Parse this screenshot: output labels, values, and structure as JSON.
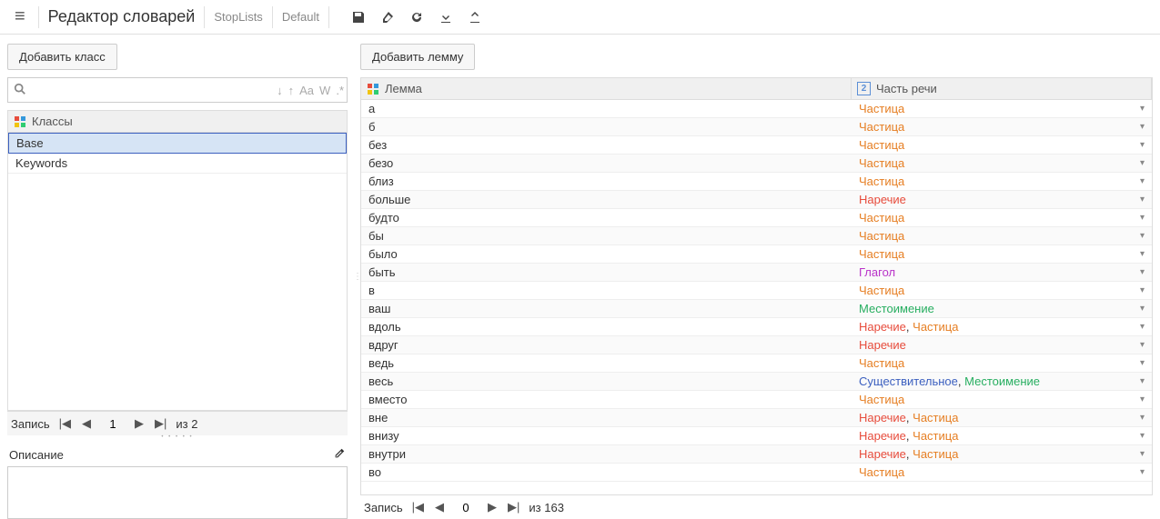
{
  "header": {
    "title": "Редактор словарей",
    "breadcrumbs": [
      "StopLists",
      "Default"
    ]
  },
  "left": {
    "add_class_label": "Добавить класс",
    "search_placeholder": "",
    "search_opts": [
      "↓",
      "↑",
      "Aa",
      "W",
      ".*"
    ],
    "classes_header": "Классы",
    "classes": [
      "Base",
      "Keywords"
    ],
    "selected_class_index": 0,
    "pager": {
      "label": "Запись",
      "current": "1",
      "of_label": "из 2"
    },
    "description_label": "Описание"
  },
  "right": {
    "add_lemma_label": "Добавить лемму",
    "columns": {
      "lemma": "Лемма",
      "pos": "Часть речи",
      "pos_badge": "2"
    },
    "pager": {
      "label": "Запись",
      "current": "0",
      "of_label": "из 163"
    },
    "rows": [
      {
        "lemma": "а",
        "pos": [
          {
            "text": "Частица",
            "cls": "pos-particle"
          }
        ]
      },
      {
        "lemma": "б",
        "pos": [
          {
            "text": "Частица",
            "cls": "pos-particle"
          }
        ]
      },
      {
        "lemma": "без",
        "pos": [
          {
            "text": "Частица",
            "cls": "pos-particle"
          }
        ]
      },
      {
        "lemma": "безо",
        "pos": [
          {
            "text": "Частица",
            "cls": "pos-particle"
          }
        ]
      },
      {
        "lemma": "близ",
        "pos": [
          {
            "text": "Частица",
            "cls": "pos-particle"
          }
        ]
      },
      {
        "lemma": "больше",
        "pos": [
          {
            "text": "Наречие",
            "cls": "pos-adverb"
          }
        ]
      },
      {
        "lemma": "будто",
        "pos": [
          {
            "text": "Частица",
            "cls": "pos-particle"
          }
        ]
      },
      {
        "lemma": "бы",
        "pos": [
          {
            "text": "Частица",
            "cls": "pos-particle"
          }
        ]
      },
      {
        "lemma": "было",
        "pos": [
          {
            "text": "Частица",
            "cls": "pos-particle"
          }
        ]
      },
      {
        "lemma": "быть",
        "pos": [
          {
            "text": "Глагол",
            "cls": "pos-verb"
          }
        ]
      },
      {
        "lemma": "в",
        "pos": [
          {
            "text": "Частица",
            "cls": "pos-particle"
          }
        ]
      },
      {
        "lemma": "ваш",
        "pos": [
          {
            "text": "Местоимение",
            "cls": "pos-pronoun"
          }
        ]
      },
      {
        "lemma": "вдоль",
        "pos": [
          {
            "text": "Наречие",
            "cls": "pos-adverb"
          },
          {
            "text": "Частица",
            "cls": "pos-particle"
          }
        ]
      },
      {
        "lemma": "вдруг",
        "pos": [
          {
            "text": "Наречие",
            "cls": "pos-adverb"
          }
        ]
      },
      {
        "lemma": "ведь",
        "pos": [
          {
            "text": "Частица",
            "cls": "pos-particle"
          }
        ]
      },
      {
        "lemma": "весь",
        "pos": [
          {
            "text": "Существительное",
            "cls": "pos-noun"
          },
          {
            "text": "Местоимение",
            "cls": "pos-pronoun"
          }
        ]
      },
      {
        "lemma": "вместо",
        "pos": [
          {
            "text": "Частица",
            "cls": "pos-particle"
          }
        ]
      },
      {
        "lemma": "вне",
        "pos": [
          {
            "text": "Наречие",
            "cls": "pos-adverb"
          },
          {
            "text": "Частица",
            "cls": "pos-particle"
          }
        ]
      },
      {
        "lemma": "внизу",
        "pos": [
          {
            "text": "Наречие",
            "cls": "pos-adverb"
          },
          {
            "text": "Частица",
            "cls": "pos-particle"
          }
        ]
      },
      {
        "lemma": "внутри",
        "pos": [
          {
            "text": "Наречие",
            "cls": "pos-adverb"
          },
          {
            "text": "Частица",
            "cls": "pos-particle"
          }
        ]
      },
      {
        "lemma": "во",
        "pos": [
          {
            "text": "Частица",
            "cls": "pos-particle"
          }
        ]
      }
    ]
  }
}
